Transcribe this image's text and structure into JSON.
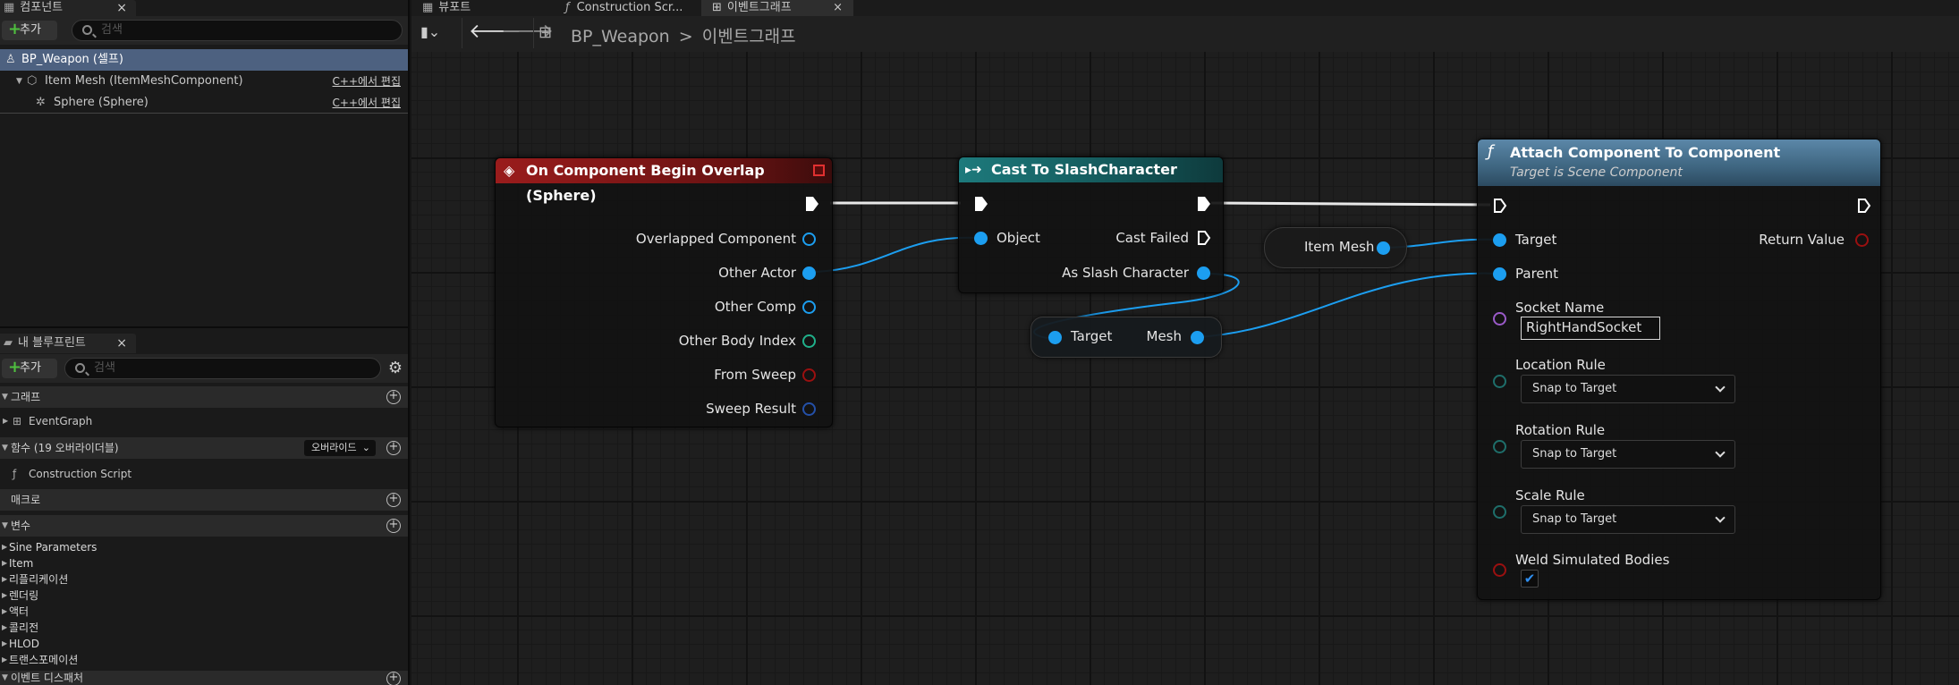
{
  "components_panel": {
    "tab_label": "컴포넌트",
    "add_label": "추가",
    "search_placeholder": "검색",
    "root": "BP_Weapon (셀프)",
    "items": [
      {
        "label": "Item Mesh (ItemMeshComponent)",
        "action": "C++에서 편집"
      },
      {
        "label": "Sphere (Sphere)",
        "action": "C++에서 편집"
      }
    ]
  },
  "blueprint_panel": {
    "tab_label": "내 블루프린트",
    "add_label": "추가",
    "search_placeholder": "검색",
    "graph_section": "그래프",
    "event_graph": "EventGraph",
    "functions_section": "함수 (19 오버라이더블)",
    "override_label": "오버라이드",
    "construction_script": "Construction Script",
    "macros_section": "매크로",
    "variables_section": "변수",
    "variables": [
      "Sine Parameters",
      "Item",
      "리플리케이션",
      "렌더링",
      "액터",
      "콜리전",
      "HLOD",
      "트랜스포메이션"
    ],
    "event_dispatchers_section": "이벤트 디스패처"
  },
  "editor_tabs": [
    {
      "label": "뷰포트",
      "icon": "viewport-icon"
    },
    {
      "label": "Construction Scr...",
      "icon": "function-icon"
    },
    {
      "label": "이벤트그래프",
      "icon": "graph-icon"
    }
  ],
  "breadcrumb": {
    "root": "BP_Weapon",
    "separator": ">",
    "current": "이벤트그래프"
  },
  "nodes": {
    "overlap": {
      "title": "On Component Begin Overlap (Sphere)",
      "pins": [
        "Overlapped Component",
        "Other Actor",
        "Other Comp",
        "Other Body Index",
        "From Sweep",
        "Sweep Result"
      ]
    },
    "cast": {
      "title": "Cast To SlashCharacter",
      "object_pin": "Object",
      "cast_failed": "Cast Failed",
      "as_pin": "As Slash Character"
    },
    "item_mesh": {
      "label": "Item Mesh"
    },
    "get_mesh": {
      "target": "Target",
      "output": "Mesh"
    },
    "attach": {
      "title": "Attach Component To Component",
      "subtitle": "Target is Scene Component",
      "target": "Target",
      "parent": "Parent",
      "return_value": "Return Value",
      "socket_name_label": "Socket Name",
      "socket_name_value": "RightHandSocket",
      "location_rule_label": "Location Rule",
      "location_rule_value": "Snap to Target",
      "rotation_rule_label": "Rotation Rule",
      "rotation_rule_value": "Snap to Target",
      "scale_rule_label": "Scale Rule",
      "scale_rule_value": "Snap to Target",
      "weld_label": "Weld Simulated Bodies",
      "weld_checked": true
    }
  },
  "colors": {
    "event_header": "#8a1a1a",
    "cast_header": "#1d6c6e",
    "function_header": "#4f7a9a",
    "object_pin": "#1c9ef0",
    "selection": "#4d6180"
  }
}
